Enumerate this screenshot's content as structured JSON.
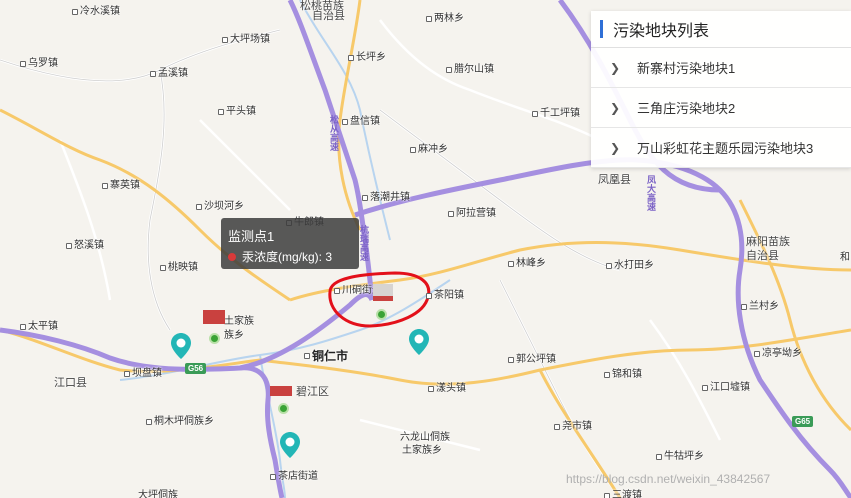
{
  "map": {
    "places": [
      {
        "name": "冷水溪镇",
        "cls": "",
        "id": "lengshuixi"
      },
      {
        "name": "松桃苗族",
        "cls": "county",
        "id": "songtao1"
      },
      {
        "name": "自治县",
        "cls": "county",
        "id": "songtao2"
      },
      {
        "name": "两林乡",
        "cls": "",
        "id": "lianglin"
      },
      {
        "name": "大坪场镇",
        "cls": "",
        "id": "dapingchang"
      },
      {
        "name": "乌罗镇",
        "cls": "",
        "id": "wuluo"
      },
      {
        "name": "长坪乡",
        "cls": "",
        "id": "changping"
      },
      {
        "name": "孟溪镇",
        "cls": "",
        "id": "mengxi"
      },
      {
        "name": "腊尔山镇",
        "cls": "",
        "id": "laershan"
      },
      {
        "name": "平头镇",
        "cls": "",
        "id": "pingtou"
      },
      {
        "name": "盘信镇",
        "cls": "",
        "id": "panxin"
      },
      {
        "name": "千工坪镇",
        "cls": "",
        "id": "qiangongping"
      },
      {
        "name": "麻冲乡",
        "cls": "",
        "id": "machong"
      },
      {
        "name": "寨英镇",
        "cls": "",
        "id": "zhaiying"
      },
      {
        "name": "落潮井镇",
        "cls": "",
        "id": "luochaojing"
      },
      {
        "name": "凤凰县",
        "cls": "county",
        "id": "fenghuang"
      },
      {
        "name": "沙坝河乡",
        "cls": "",
        "id": "shabahe"
      },
      {
        "name": "阿拉营镇",
        "cls": "",
        "id": "alaying"
      },
      {
        "name": "牛郎镇",
        "cls": "",
        "id": "niulang"
      },
      {
        "name": "怒溪镇",
        "cls": "",
        "id": "nuxi"
      },
      {
        "name": "麻阳苗族",
        "cls": "county",
        "id": "mayang1"
      },
      {
        "name": "自治县",
        "cls": "county",
        "id": "mayang2"
      },
      {
        "name": "桃映镇",
        "cls": "",
        "id": "taoying"
      },
      {
        "name": "林峰乡",
        "cls": "",
        "id": "linfeng"
      },
      {
        "name": "水打田乡",
        "cls": "",
        "id": "shuidatian"
      },
      {
        "name": "川硐街道",
        "cls": "",
        "id": "chuandong"
      },
      {
        "name": "茶阳镇",
        "cls": "",
        "id": "chayang"
      },
      {
        "name": "土家族",
        "cls": "",
        "id": "tujiazu"
      },
      {
        "name": "族乡",
        "cls": "",
        "id": "zuxiang"
      },
      {
        "name": "兰村乡",
        "cls": "",
        "id": "lancun"
      },
      {
        "name": "太平镇",
        "cls": "",
        "id": "taiping"
      },
      {
        "name": "铜仁市",
        "cls": "city",
        "id": "tongren"
      },
      {
        "name": "郭公坪镇",
        "cls": "",
        "id": "guogongping"
      },
      {
        "name": "凉亭坳乡",
        "cls": "",
        "id": "liangtingao"
      },
      {
        "name": "江口县",
        "cls": "county",
        "id": "jiangkou"
      },
      {
        "name": "坝盘镇",
        "cls": "",
        "id": "bapan"
      },
      {
        "name": "碧江区",
        "cls": "county",
        "id": "bijiang"
      },
      {
        "name": "漾头镇",
        "cls": "",
        "id": "yangtou"
      },
      {
        "name": "锦和镇",
        "cls": "",
        "id": "jinhe"
      },
      {
        "name": "江口墟镇",
        "cls": "",
        "id": "jiangkouxu"
      },
      {
        "name": "桐木坪侗族乡",
        "cls": "",
        "id": "tongmuping"
      },
      {
        "name": "尧市镇",
        "cls": "",
        "id": "yaoshi"
      },
      {
        "name": "六龙山侗族",
        "cls": "",
        "id": "liulongshan1"
      },
      {
        "name": "土家族乡",
        "cls": "",
        "id": "liulongshan2"
      },
      {
        "name": "牛牯坪乡",
        "cls": "",
        "id": "niuguping"
      },
      {
        "name": "茶店街道",
        "cls": "",
        "id": "chadian"
      },
      {
        "name": "大坪侗族",
        "cls": "",
        "id": "dapingdong"
      },
      {
        "name": "三渡镇",
        "cls": "",
        "id": "sandu"
      },
      {
        "name": "和",
        "cls": "",
        "id": "he"
      }
    ],
    "road_labels": {
      "songcong": "松从高速",
      "hangrui": "杭瑞高速",
      "fengda": "凤大高速",
      "g56": "G56",
      "g65": "G65"
    },
    "colors": {
      "expressway": "#a58fe0",
      "national_road": "#f7c96a",
      "river": "#b8d4ef",
      "land": "#f5f3ee",
      "accent": "#2f6fd6",
      "pin": "#23b6b6",
      "marker_green": "#3aa335",
      "marker_red": "#c9413f",
      "annotation": "#e3101a"
    }
  },
  "panel": {
    "title": "污染地块列表",
    "items": [
      {
        "label": "新寨村污染地块1"
      },
      {
        "label": "三角庄污染地块2"
      },
      {
        "label": "万山彩虹花主题乐园污染地块3"
      }
    ]
  },
  "tooltip": {
    "title": "监测点1",
    "metric": "汞浓度(mg/kg): 3"
  },
  "watermark": "https://blog.csdn.net/weixin_43842567"
}
